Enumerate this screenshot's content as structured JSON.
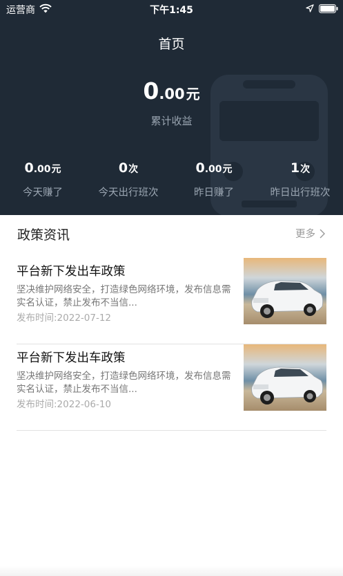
{
  "status_bar": {
    "carrier": "运营商",
    "time": "下午1:45"
  },
  "nav": {
    "title": "首页"
  },
  "earnings": {
    "total_int": "0",
    "total_dec": ".00",
    "total_unit": "元",
    "total_label": "累计收益"
  },
  "stats": [
    {
      "int": "0",
      "dec": ".00",
      "unit": "元",
      "label": "今天赚了"
    },
    {
      "int": "0",
      "dec": "",
      "unit": "次",
      "label": "今天出行班次"
    },
    {
      "int": "0",
      "dec": ".00",
      "unit": "元",
      "label": "昨日赚了"
    },
    {
      "int": "1",
      "dec": "",
      "unit": "次",
      "label": "昨日出行班次"
    }
  ],
  "news_section": {
    "title": "政策资讯",
    "more_label": "更多"
  },
  "news": [
    {
      "title": "平台新下发出车政策",
      "desc": "坚决维护网络安全，打造绿色网络环境，发布信息需实名认证，禁止发布不当信...",
      "date": "发布时间:2022-07-12",
      "image_icon": "white-suv-car-icon"
    },
    {
      "title": "平台新下发出车政策",
      "desc": "坚决维护网络安全，打造绿色网络环境，发布信息需实名认证，禁止发布不当信...",
      "date": "发布时间:2022-06-10",
      "image_icon": "white-suv-car-icon"
    }
  ],
  "colors": {
    "header_bg": "#1f2a36",
    "sub_text": "#9aa5b1",
    "divider": "#e2e2e2"
  }
}
